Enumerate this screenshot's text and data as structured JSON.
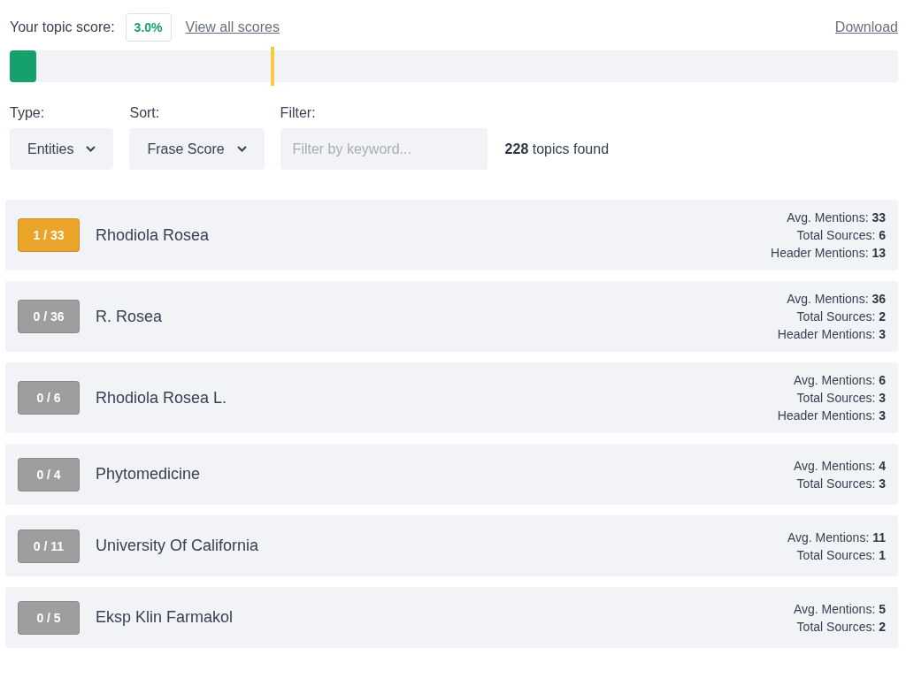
{
  "score": {
    "label": "Your topic score:",
    "value": "3.0%",
    "link": "View all scores",
    "download": "Download",
    "level": 0.03
  },
  "controls": [
    {
      "label": "Type:",
      "kind": "select",
      "value": "Entities"
    },
    {
      "label": "Sort:",
      "kind": "select",
      "value": "Frase Score"
    },
    {
      "label": "Filter:",
      "kind": "input",
      "placeholder": "Filter by keyword..."
    }
  ],
  "found": {
    "count": "228",
    "text": "topics found"
  },
  "topics": [
    {
      "badge": "1 / 33",
      "color": "#eba42a",
      "name": "Rhodiola Rosea",
      "stats": [
        {
          "label": "Avg. Mentions:",
          "value": "33"
        },
        {
          "label": "Total Sources:",
          "value": "6"
        },
        {
          "label": "Header Mentions:",
          "value": "13"
        }
      ]
    },
    {
      "badge": "0 / 36",
      "color": "#9e9e9e",
      "name": "R. Rosea",
      "stats": [
        {
          "label": "Avg. Mentions:",
          "value": "36"
        },
        {
          "label": "Total Sources:",
          "value": "2"
        },
        {
          "label": "Header Mentions:",
          "value": "3"
        }
      ]
    },
    {
      "badge": "0 / 6",
      "color": "#9e9e9e",
      "name": "Rhodiola Rosea L.",
      "stats": [
        {
          "label": "Avg. Mentions:",
          "value": "6"
        },
        {
          "label": "Total Sources:",
          "value": "3"
        },
        {
          "label": "Header Mentions:",
          "value": "3"
        }
      ]
    },
    {
      "badge": "0 / 4",
      "color": "#9e9e9e",
      "name": "Phytomedicine",
      "stats": [
        {
          "label": "Avg. Mentions:",
          "value": "4"
        },
        {
          "label": "Total Sources:",
          "value": "3"
        }
      ]
    },
    {
      "badge": "0 / 11",
      "color": "#9e9e9e",
      "name": "University Of California",
      "stats": [
        {
          "label": "Avg. Mentions:",
          "value": "11"
        },
        {
          "label": "Total Sources:",
          "value": "1"
        }
      ]
    },
    {
      "badge": "0 / 5",
      "color": "#9e9e9e",
      "name": "Eksp Klin Farmakol",
      "stats": [
        {
          "label": "Avg. Mentions:",
          "value": "5"
        },
        {
          "label": "Total Sources:",
          "value": "2"
        }
      ]
    }
  ]
}
